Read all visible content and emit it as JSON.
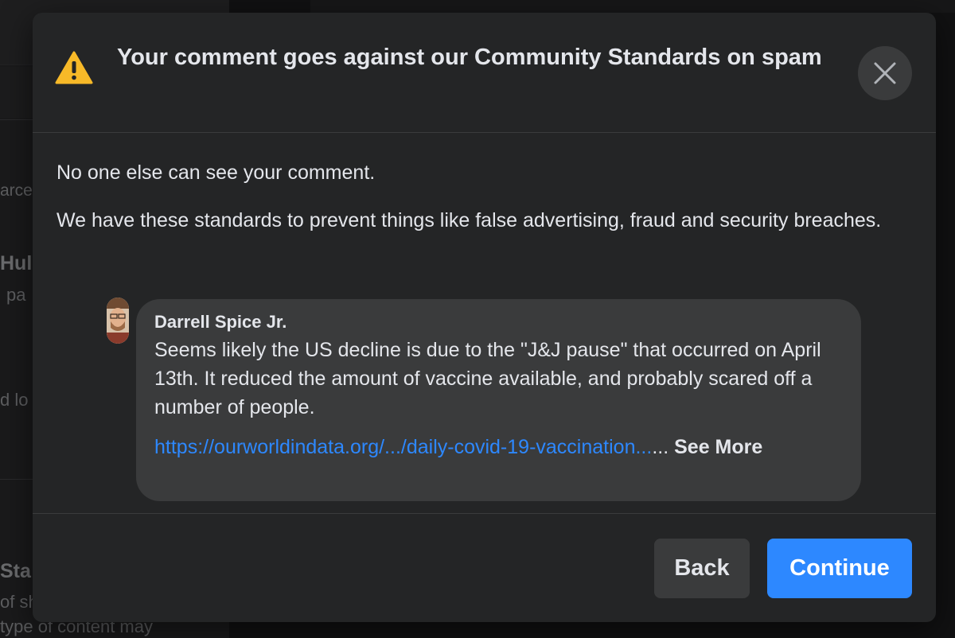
{
  "dialog": {
    "title": "Your comment goes against our Community Standards on spam",
    "warning_icon": "warning-triangle-icon",
    "close_icon": "close-icon",
    "warning_color": "#f7b928",
    "accent_color": "#2d88ff"
  },
  "body": {
    "paragraph_1": "No one else can see your comment.",
    "paragraph_2": "We have these standards to prevent things like false advertising, fraud and security breaches."
  },
  "comment": {
    "author": "Darrell Spice Jr.",
    "text": "Seems likely the US decline is due to the \"J&J pause\" that occurred on April 13th. It reduced the amount of vaccine available, and probably scared off a number of people.",
    "link": "https://ourworldindata.org/.../daily-covid-19-vaccination...",
    "ellipsis": "...",
    "see_more": "See More"
  },
  "footer": {
    "back_label": "Back",
    "continue_label": "Continue"
  },
  "background": {
    "fragments": [
      "arce",
      "Hul",
      "pa",
      "d lo",
      "Sta",
      "of sh",
      "type of content may"
    ]
  }
}
